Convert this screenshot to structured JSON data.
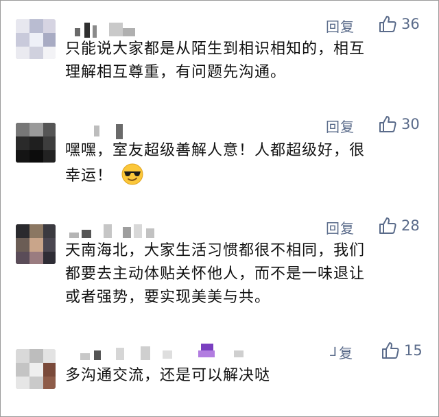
{
  "comments": [
    {
      "reply_label": "回复",
      "likes": "36",
      "text_lines": [
        "只能说大家都是从陌生到相识相知的，相互",
        "理解相互尊重，有问题先沟通。"
      ]
    },
    {
      "reply_label": "回复",
      "likes": "30",
      "text_lines": [
        "嘿嘿，室友超级善解人意！人都超级好，很",
        "幸运！"
      ]
    },
    {
      "reply_label": "回复",
      "likes": "28",
      "text_lines": [
        "天南海北，大家生活习惯都很不相同，我们",
        "都要去主动体贴关怀他人，而不是一味退让",
        "或者强势，要实现美美与共。"
      ]
    },
    {
      "reply_label": "复",
      "likes": "15",
      "text_lines": [
        "多沟通交流，还是可以解决哒"
      ]
    }
  ],
  "colors": {
    "meta": "#5a6b8a",
    "text": "#111111",
    "border": "#9a9a9a"
  },
  "icons": {
    "reply": "reply-icon",
    "like": "thumbs-up-icon",
    "emoji": "cool-sunglasses-emoji-icon"
  }
}
